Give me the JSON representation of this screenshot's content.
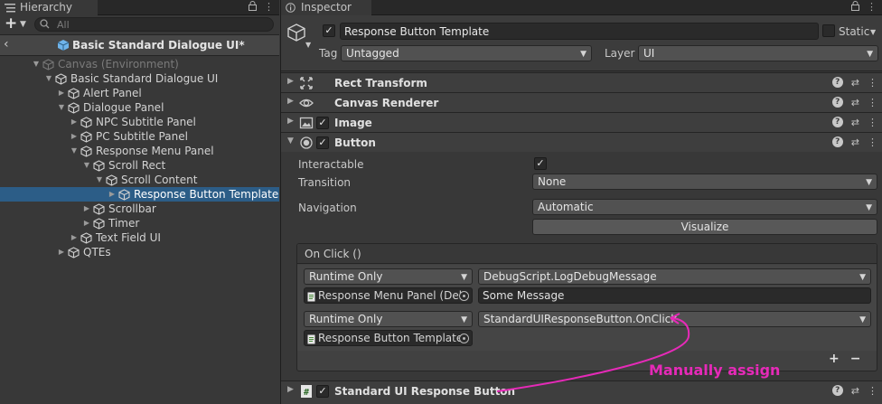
{
  "colors": {
    "accent": "#e62ab8",
    "selection": "#2c5d87",
    "cube": "#9fcbef"
  },
  "hierarchy": {
    "tab_label": "Hierarchy",
    "search_placeholder": "All",
    "scene_title": "Basic Standard Dialogue UI*",
    "items": [
      {
        "label": "Canvas (Environment)",
        "depth": 0,
        "fold": "expanded",
        "dim": true
      },
      {
        "label": "Basic Standard Dialogue UI",
        "depth": 1,
        "fold": "expanded"
      },
      {
        "label": "Alert Panel",
        "depth": 2,
        "fold": "collapsed"
      },
      {
        "label": "Dialogue Panel",
        "depth": 2,
        "fold": "expanded"
      },
      {
        "label": "NPC Subtitle Panel",
        "depth": 3,
        "fold": "collapsed"
      },
      {
        "label": "PC Subtitle Panel",
        "depth": 3,
        "fold": "collapsed"
      },
      {
        "label": "Response Menu Panel",
        "depth": 3,
        "fold": "expanded"
      },
      {
        "label": "Scroll Rect",
        "depth": 4,
        "fold": "expanded"
      },
      {
        "label": "Scroll Content",
        "depth": 5,
        "fold": "expanded"
      },
      {
        "label": "Response Button Template",
        "depth": 6,
        "fold": "collapsed",
        "selected": true
      },
      {
        "label": "Scrollbar",
        "depth": 4,
        "fold": "collapsed"
      },
      {
        "label": "Timer",
        "depth": 4,
        "fold": "collapsed"
      },
      {
        "label": "Text Field UI",
        "depth": 3,
        "fold": "collapsed"
      },
      {
        "label": "QTEs",
        "depth": 2,
        "fold": "collapsed"
      }
    ]
  },
  "inspector": {
    "tab_label": "Inspector",
    "object_name": "Response Button Template",
    "static_label": "Static",
    "tag_label": "Tag",
    "tag_value": "Untagged",
    "layer_label": "Layer",
    "layer_value": "UI",
    "components": [
      {
        "name": "Rect Transform",
        "icon": "rect-transform-icon",
        "has_checkbox": false
      },
      {
        "name": "Canvas Renderer",
        "icon": "eye-icon",
        "has_checkbox": false
      },
      {
        "name": "Image",
        "icon": "image-icon",
        "has_checkbox": true
      },
      {
        "name": "Button",
        "icon": "button-icon",
        "has_checkbox": true
      }
    ],
    "button": {
      "interactable_label": "Interactable",
      "transition_label": "Transition",
      "transition_value": "None",
      "navigation_label": "Navigation",
      "navigation_value": "Automatic",
      "visualize_label": "Visualize",
      "onclick_header": "On Click ()",
      "events": [
        {
          "runtime": "Runtime Only",
          "function": "DebugScript.LogDebugMessage",
          "object": "Response Menu Panel (Deb",
          "argument": "Some Message"
        },
        {
          "runtime": "Runtime Only",
          "function": "StandardUIResponseButton.OnClick",
          "object": "Response Button Template",
          "argument": ""
        }
      ],
      "add_label": "+",
      "remove_label": "−"
    },
    "last_component": {
      "name": "Standard UI Response Button",
      "icon": "script-icon"
    }
  },
  "annotation": {
    "text": "Manually assign"
  }
}
